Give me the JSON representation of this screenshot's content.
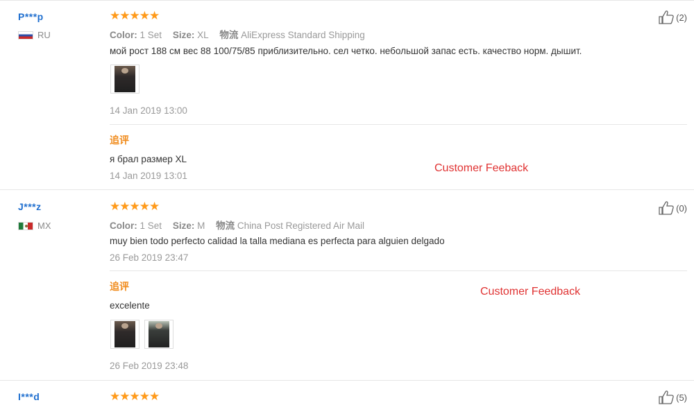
{
  "reviews": [
    {
      "user": "P***p",
      "country": "RU",
      "stars": "★★★★★",
      "color_label": "Color:",
      "color_value": "1 Set",
      "size_label": "Size:",
      "size_value": "XL",
      "shipping_label": "物流",
      "shipping_value": "AliExpress Standard Shipping",
      "text": "мой рост 188 см вес 88 100/75/85 приблизительно. сел четко. небольшой запас есть. качество норм. дышит.",
      "date": "14 Jan 2019 13:00",
      "likes": "(2)",
      "additional": {
        "label": "追评",
        "text": "я брал размер XL",
        "date": "14 Jan 2019 13:01"
      },
      "annotation": "Customer Feeback"
    },
    {
      "user": "J***z",
      "country": "MX",
      "stars": "★★★★★",
      "color_label": "Color:",
      "color_value": "1 Set",
      "size_label": "Size:",
      "size_value": "M",
      "shipping_label": "物流",
      "shipping_value": "China Post Registered Air Mail",
      "text": "muy bien todo perfecto calidad la talla mediana es perfecta para alguien delgado",
      "date": "26 Feb 2019 23:47",
      "likes": "(0)",
      "additional": {
        "label": "追评",
        "text": "excelente",
        "date": "26 Feb 2019 23:48"
      },
      "annotation": "Customer Feedback"
    },
    {
      "user": "I***d",
      "stars": "★★★★★",
      "likes": "(5)"
    }
  ],
  "colors": {
    "link": "#1f6fcf",
    "star": "#ff9a1a",
    "followup": "#f08a1a",
    "annotation": "#e03232"
  }
}
